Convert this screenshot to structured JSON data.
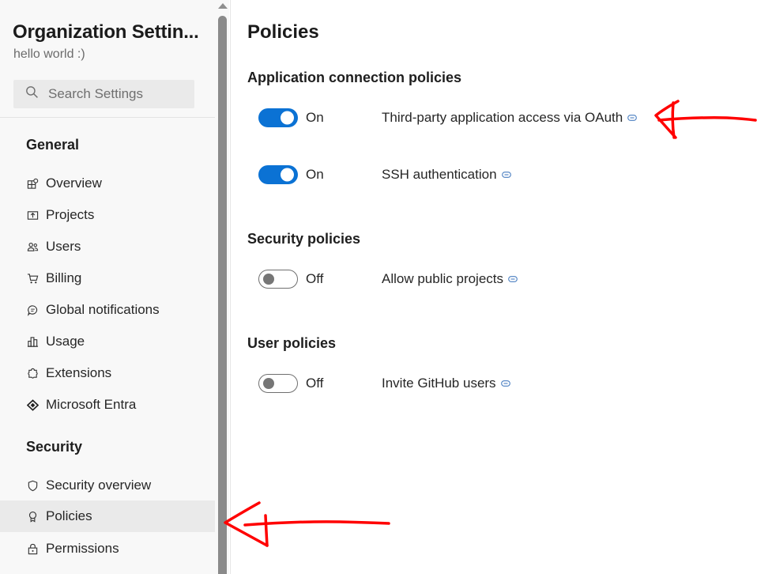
{
  "sidebar": {
    "title": "Organization Settin...",
    "subtitle": "hello world :)",
    "search": {
      "placeholder": "Search Settings",
      "icon": "search-icon"
    },
    "sections": [
      {
        "heading": "General",
        "items": [
          {
            "label": "Overview",
            "icon": "overview-icon"
          },
          {
            "label": "Projects",
            "icon": "projects-icon"
          },
          {
            "label": "Users",
            "icon": "users-icon"
          },
          {
            "label": "Billing",
            "icon": "cart-icon"
          },
          {
            "label": "Global notifications",
            "icon": "chat-bubble-icon"
          },
          {
            "label": "Usage",
            "icon": "bar-chart-icon"
          },
          {
            "label": "Extensions",
            "icon": "puzzle-icon"
          },
          {
            "label": "Microsoft Entra",
            "icon": "entra-icon"
          }
        ]
      },
      {
        "heading": "Security",
        "items": [
          {
            "label": "Security overview",
            "icon": "shield-icon"
          },
          {
            "label": "Policies",
            "icon": "ribbon-icon",
            "selected": true
          },
          {
            "label": "Permissions",
            "icon": "lock-icon"
          }
        ]
      }
    ]
  },
  "main": {
    "title": "Policies",
    "groups": [
      {
        "heading": "Application connection policies",
        "policies": [
          {
            "label": "Third-party application access via OAuth",
            "state": "On",
            "enabled": true
          },
          {
            "label": "SSH authentication",
            "state": "On",
            "enabled": true
          }
        ]
      },
      {
        "heading": "Security policies",
        "policies": [
          {
            "label": "Allow public projects",
            "state": "Off",
            "enabled": false
          }
        ]
      },
      {
        "heading": "User policies",
        "policies": [
          {
            "label": "Invite GitHub users",
            "state": "Off",
            "enabled": false
          }
        ]
      }
    ]
  },
  "annotations": {
    "color": "#ff0000",
    "arrows": [
      "arrow-to-oauth-policy",
      "arrow-to-policies-nav"
    ]
  },
  "colors": {
    "toggle_on": "#0b72d4",
    "selected_nav_bg": "#eaeaea",
    "sidebar_bg": "#f8f8f8"
  }
}
